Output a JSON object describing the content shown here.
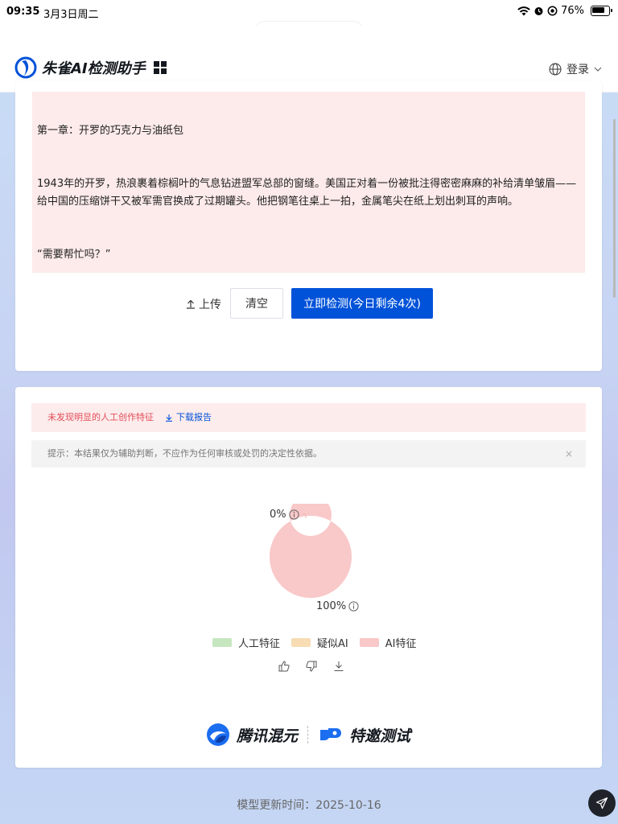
{
  "status_bar": {
    "time": "09:35",
    "date": "3月3日周二",
    "battery": "76%"
  },
  "browser": {
    "url": "matrix.tencent.com"
  },
  "header": {
    "title": "朱雀AI检测助手",
    "login_label": "登录"
  },
  "editor": {
    "lines": [
      "第一章：开罗的巧克力与油纸包",
      "1943年的开罗，热浪裹着棕榈叶的气息钻进盟军总部的窗缝。美国正对着一份被批注得密密麻麻的补给清单皱眉——给中国的压缩饼干又被军需官换成了过期罐头。他把钢笔往桌上一拍，金属笔尖在纸上划出刺耳的声响。",
      "“需要帮忙吗？”"
    ],
    "upload_label": "上传",
    "clear_label": "清空",
    "detect_label": "立即检测(今日剩余4次)"
  },
  "result": {
    "alert_message": "未发现明显的人工创作特征",
    "download_label": "下载报告",
    "tip": "提示：本结果仅为辅助判断，不应作为任何审核或处罚的决定性依据。",
    "close_glyph": "×"
  },
  "chart_data": {
    "type": "pie",
    "categories": [
      "人工特征",
      "疑似AI",
      "AI特征"
    ],
    "values": [
      0,
      0,
      100
    ],
    "colors": [
      "#c6e6c0",
      "#f7dcb4",
      "#f9c8c8"
    ],
    "labels": [
      "0%",
      "100%"
    ],
    "legend_position": "bottom"
  },
  "brand": {
    "left": "腾讯混元",
    "right": "特邀测试"
  },
  "footer": {
    "update_time": "模型更新时间：2025-10-16"
  }
}
